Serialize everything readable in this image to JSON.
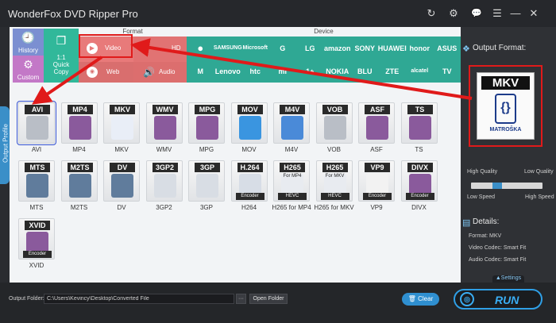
{
  "app": {
    "title": "WonderFox DVD Ripper Pro"
  },
  "window_controls": [
    {
      "name": "refresh-icon",
      "glyph": "↻"
    },
    {
      "name": "gear-icon",
      "glyph": "⚙"
    },
    {
      "name": "chat-icon",
      "glyph": "💬"
    },
    {
      "name": "menu-icon",
      "glyph": "☰"
    },
    {
      "name": "minimize-icon",
      "glyph": "—"
    },
    {
      "name": "close-icon",
      "glyph": "✕"
    }
  ],
  "side_tab": {
    "label": "Output Profile"
  },
  "categories": {
    "format_header": "Format",
    "device_header": "Device",
    "history": "History",
    "custom": "Custom",
    "quick": [
      "1:1",
      "Quick",
      "Copy"
    ],
    "video": "Video",
    "web": "Web",
    "hd": "HD",
    "audio": "Audio"
  },
  "brands": [
    {
      "name": "brand-apple",
      "label": ""
    },
    {
      "name": "brand-samsung",
      "label": "SAMSUNG"
    },
    {
      "name": "brand-microsoft",
      "label": "Microsoft"
    },
    {
      "name": "brand-google",
      "label": "G"
    },
    {
      "name": "brand-lg",
      "label": "LG"
    },
    {
      "name": "brand-amazon",
      "label": "amazon"
    },
    {
      "name": "brand-sony",
      "label": "SONY"
    },
    {
      "name": "brand-huawei",
      "label": "HUAWEI"
    },
    {
      "name": "brand-honor",
      "label": "honor"
    },
    {
      "name": "brand-asus",
      "label": "ASUS"
    },
    {
      "name": "brand-motorola",
      "label": "M"
    },
    {
      "name": "brand-lenovo",
      "label": "Lenovo"
    },
    {
      "name": "brand-htc",
      "label": "htc"
    },
    {
      "name": "brand-mi",
      "label": "mi"
    },
    {
      "name": "brand-oneplus",
      "label": "1+"
    },
    {
      "name": "brand-nokia",
      "label": "NOKIA"
    },
    {
      "name": "brand-blu",
      "label": "BLU"
    },
    {
      "name": "brand-zte",
      "label": "ZTE"
    },
    {
      "name": "brand-alcatel",
      "label": "alcatel"
    },
    {
      "name": "brand-tv",
      "label": "TV"
    }
  ],
  "profiles": [
    {
      "tag": "AVI",
      "name": "AVI",
      "art": "disc",
      "selected": true
    },
    {
      "tag": "MP4",
      "name": "MP4",
      "art": "film"
    },
    {
      "tag": "MKV",
      "name": "MKV",
      "art": "mkv"
    },
    {
      "tag": "WMV",
      "name": "WMV",
      "art": "film"
    },
    {
      "tag": "MPG",
      "name": "MPG",
      "art": "film"
    },
    {
      "tag": "MOV",
      "name": "MOV",
      "art": "quicktime"
    },
    {
      "tag": "M4V",
      "name": "M4V",
      "art": "itunes"
    },
    {
      "tag": "VOB",
      "name": "VOB",
      "art": "disc"
    },
    {
      "tag": "ASF",
      "name": "ASF",
      "art": "film"
    },
    {
      "tag": "TS",
      "name": "TS",
      "art": "film"
    },
    {
      "tag": "MTS",
      "name": "MTS",
      "art": "camcorder"
    },
    {
      "tag": "M2TS",
      "name": "M2TS",
      "art": "camcorder"
    },
    {
      "tag": "DV",
      "name": "DV",
      "art": "camcorder"
    },
    {
      "tag": "3GP2",
      "name": "3GP2",
      "art": "phone"
    },
    {
      "tag": "3GP",
      "name": "3GP",
      "art": "phone"
    },
    {
      "tag": "H.264",
      "name": "H264",
      "art": "h264",
      "sub": "Encoder"
    },
    {
      "tag": "H265",
      "name": "H265 for MP4",
      "art": "hevc",
      "caption": "For MP4",
      "sub": "HEVC"
    },
    {
      "tag": "H265",
      "name": "H265 for MKV",
      "art": "hevc",
      "caption": "For MKV",
      "sub": "HEVC"
    },
    {
      "tag": "VP9",
      "name": "VP9",
      "art": "vp9",
      "sub": "Encoder"
    },
    {
      "tag": "DIVX",
      "name": "DIVX",
      "art": "film",
      "sub": "Encoder"
    },
    {
      "tag": "XVID",
      "name": "XVID",
      "art": "film",
      "sub": "Encoder"
    }
  ],
  "right_panel": {
    "output_format_label": "Output Format:",
    "format_card": {
      "tag": "MKV",
      "subtitle": "MATROŠKA"
    },
    "quality_high_left": "High Quality",
    "quality_low_right": "Low Quality",
    "speed_low_left": "Low Speed",
    "speed_high_right": "High Speed",
    "details_title": "Details:",
    "details": [
      "Format: MKV",
      "Video Codec: Smart Fit",
      "Audio Codec: Smart Fit"
    ],
    "settings_label": "▲Settings"
  },
  "bottom": {
    "output_folder_label": "Output Folder:",
    "output_folder_value": "C:\\Users\\Kevincy\\Desktop\\Converted File",
    "browse_label": "···",
    "open_folder_label": "Open Folder",
    "clear_label": "Clear",
    "run_label": "RUN"
  },
  "colors": {
    "annotation_red": "#e01a1a",
    "accent_blue": "#2f8fd0",
    "device_green": "#2fa894"
  }
}
